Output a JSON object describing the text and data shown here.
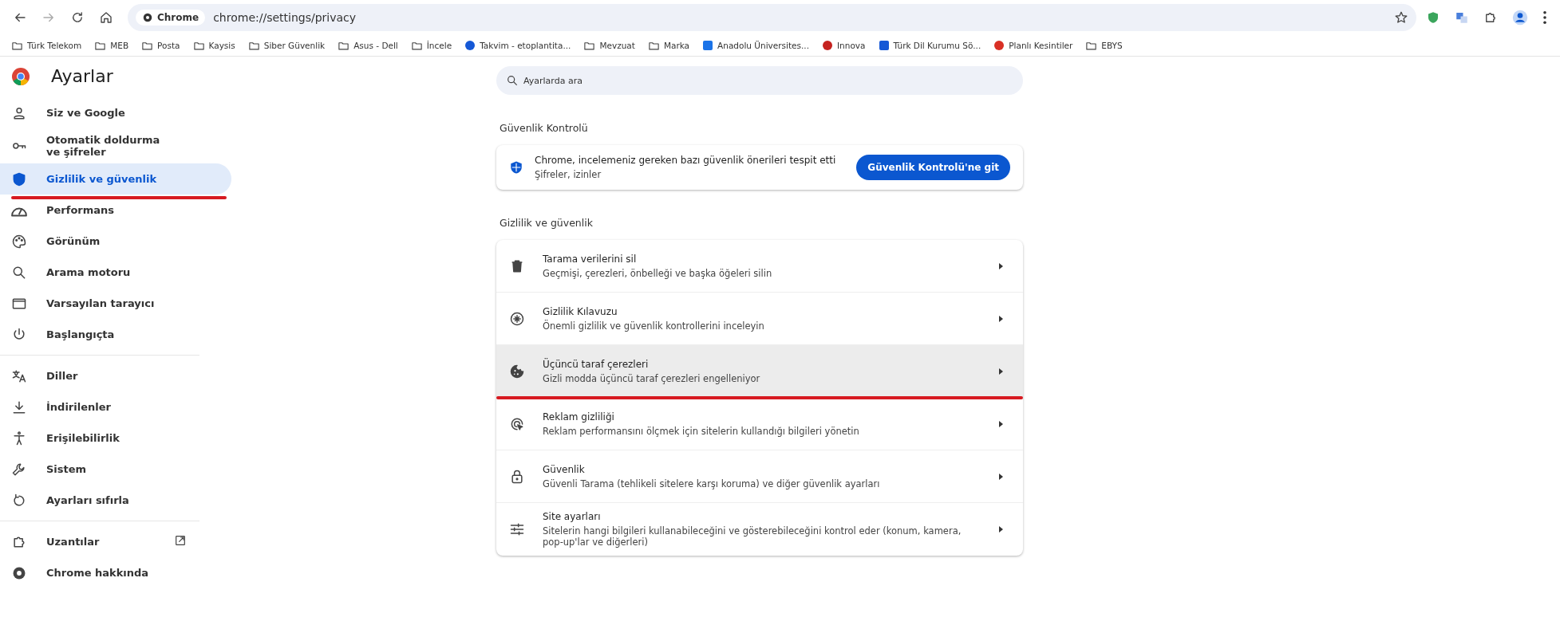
{
  "toolbar": {
    "chip": "Chrome",
    "url": "chrome://settings/privacy"
  },
  "bookmarks": [
    {
      "kind": "folder",
      "label": "Türk Telekom"
    },
    {
      "kind": "folder",
      "label": "MEB"
    },
    {
      "kind": "folder",
      "label": "Posta"
    },
    {
      "kind": "folder",
      "label": "Kaysis"
    },
    {
      "kind": "folder",
      "label": "Siber Güvenlik"
    },
    {
      "kind": "folder",
      "label": "Asus - Dell"
    },
    {
      "kind": "folder",
      "label": "İncele"
    },
    {
      "kind": "site",
      "label": "Takvim - etoplantita..."
    },
    {
      "kind": "folder",
      "label": "Mevzuat"
    },
    {
      "kind": "folder",
      "label": "Marka"
    },
    {
      "kind": "site",
      "label": "Anadolu Üniversites..."
    },
    {
      "kind": "site",
      "label": "Innova"
    },
    {
      "kind": "site",
      "label": "Türk Dil Kurumu Sö..."
    },
    {
      "kind": "site",
      "label": "Planlı Kesintiler"
    },
    {
      "kind": "folder",
      "label": "EBYS"
    }
  ],
  "sidebar": {
    "title": "Ayarlar",
    "groups": [
      [
        {
          "label": "Siz ve Google",
          "selected": false,
          "underlined": false
        },
        {
          "label": "Otomatik doldurma ve şifreler",
          "selected": false,
          "underlined": false
        },
        {
          "label": "Gizlilik ve güvenlik",
          "selected": true,
          "underlined": true
        },
        {
          "label": "Performans",
          "selected": false,
          "underlined": false
        },
        {
          "label": "Görünüm",
          "selected": false,
          "underlined": false
        },
        {
          "label": "Arama motoru",
          "selected": false,
          "underlined": false
        },
        {
          "label": "Varsayılan tarayıcı",
          "selected": false,
          "underlined": false
        },
        {
          "label": "Başlangıçta",
          "selected": false,
          "underlined": false
        }
      ],
      [
        {
          "label": "Diller",
          "selected": false,
          "underlined": false
        },
        {
          "label": "İndirilenler",
          "selected": false,
          "underlined": false
        },
        {
          "label": "Erişilebilirlik",
          "selected": false,
          "underlined": false
        },
        {
          "label": "Sistem",
          "selected": false,
          "underlined": false
        },
        {
          "label": "Ayarları sıfırla",
          "selected": false,
          "underlined": false
        }
      ],
      [
        {
          "label": "Uzantılar",
          "selected": false,
          "underlined": false,
          "external": true
        },
        {
          "label": "Chrome hakkında",
          "selected": false,
          "underlined": false,
          "external": false
        }
      ]
    ]
  },
  "search": {
    "placeholder": "Ayarlarda ara"
  },
  "safety_check": {
    "heading": "Güvenlik Kontrolü",
    "title": "Chrome, incelemeniz gereken bazı güvenlik önerileri tespit etti",
    "subtitle": "Şifreler, izinler",
    "button": "Güvenlik Kontrolü'ne git"
  },
  "privacy": {
    "heading": "Gizlilik ve güvenlik",
    "rows": [
      {
        "title": "Tarama verilerini sil",
        "subtitle": "Geçmişi, çerezleri, önbelleği ve başka öğeleri silin",
        "hovered": false,
        "underlined": false
      },
      {
        "title": "Gizlilik Kılavuzu",
        "subtitle": "Önemli gizlilik ve güvenlik kontrollerini inceleyin",
        "hovered": false,
        "underlined": false
      },
      {
        "title": "Üçüncü taraf çerezleri",
        "subtitle": "Gizli modda üçüncü taraf çerezleri engelleniyor",
        "hovered": true,
        "underlined": true
      },
      {
        "title": "Reklam gizliliği",
        "subtitle": "Reklam performansını ölçmek için sitelerin kullandığı bilgileri yönetin",
        "hovered": false,
        "underlined": false
      },
      {
        "title": "Güvenlik",
        "subtitle": "Güvenli Tarama (tehlikeli sitelere karşı koruma) ve diğer güvenlik ayarları",
        "hovered": false,
        "underlined": false
      },
      {
        "title": "Site ayarları",
        "subtitle": "Sitelerin hangi bilgileri kullanabileceğini ve gösterebileceğini kontrol eder (konum, kamera, pop-up'lar ve diğerleri)",
        "hovered": false,
        "underlined": false
      }
    ]
  }
}
